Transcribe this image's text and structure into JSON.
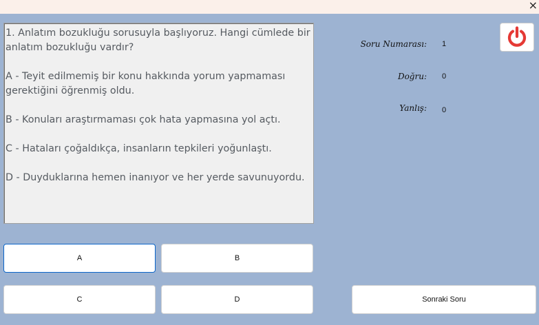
{
  "window": {
    "close_glyph": "×"
  },
  "question": {
    "text": "1. Anlatım bozukluğu sorusuyla başlıyoruz. Hangi cümlede bir anlatım bozukluğu vardır?\n\nA - Teyit edilmemiş bir konu hakkında yorum yapmaması gerektiğini öğrenmiş oldu.\n\nB - Konuları araştırmaması çok hata yapmasına yol açtı.\n\nC - Hataları çoğaldıkça, insanların tepkileri yoğunlaştı.\n\nD - Duyduklarına hemen inanıyor ve her yerde savunuyordu."
  },
  "stats": {
    "question_number_label": "Soru Numarası:",
    "question_number_value": "1",
    "correct_label": "Doğru:",
    "correct_value": "0",
    "wrong_label": "Yanlış:",
    "wrong_value": "0"
  },
  "answers": {
    "a": "A",
    "b": "B",
    "c": "C",
    "d": "D"
  },
  "next_button_label": "Sonraki Soru",
  "colors": {
    "background": "#9db3d2",
    "power_red": "#e53935",
    "focus_blue": "#0a64c8"
  },
  "icons": {
    "power": "power-icon"
  }
}
